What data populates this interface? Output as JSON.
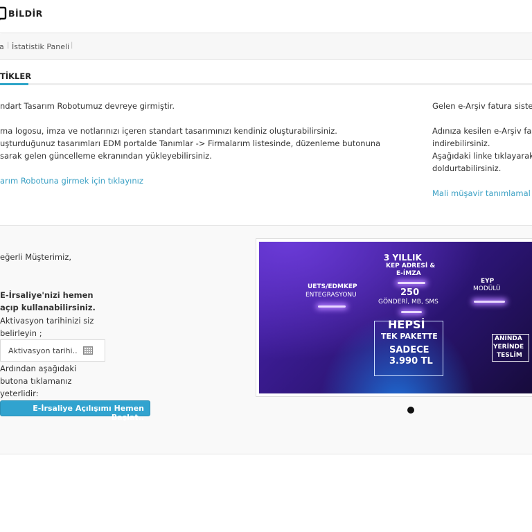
{
  "header": {
    "logo_text": "BİLDİR"
  },
  "breadcrumb": {
    "items": [
      "a",
      "İstatistik Paneli"
    ]
  },
  "tabs": [
    {
      "label": "TİKLER",
      "active": true
    }
  ],
  "notice_left": {
    "lines": [
      "ndart Tasarım Robotumuz devreye girmiştir.",
      "ma logosu, imza ve notlarınızı içeren standart tasarımınızı kendiniz oluşturabilirsiniz.",
      "uşturduğunuz tasarımları EDM portalde Tanımlar -> Firmalarım listesinde, düzenleme butonuna",
      "sarak gelen güncelleme ekranından yükleyebilirsiniz."
    ],
    "link": "arım Robotuna girmek için tıklayınız"
  },
  "notice_right": {
    "lines": [
      "Gelen e-Arşiv fatura siste",
      "Adınıza kesilen e-Arşiv fa",
      "indirebilirsiniz.",
      "Aşağıdaki linke tıklayarak",
      "doldurtabilirsiniz."
    ],
    "link": "Mali müşavir tanımlamal"
  },
  "eirsaliye": {
    "greeting": "eğerli Müşterimiz,",
    "bold1": "E-İrsaliye'nizi hemen",
    "bold2": "açıp kullanabilirsiniz.",
    "text1": "Aktivasyon tarihinizi siz",
    "text2": "belirleyin ;",
    "date_placeholder": "Aktivasyon tarihi..",
    "text3": "Ardından aşağıdaki",
    "text4": "butona tıklamanız",
    "text5": "yeterlidir:",
    "button": "E-İrsaliye Açılışımı Hemen Başlat.."
  },
  "banner": {
    "t1": "3 YILLIK",
    "t2": "KEP ADRESİ &",
    "t3": "E-İMZA",
    "uets": "UETS/EDMKEP",
    "uets2": "ENTEGRASYONU",
    "n250": "250",
    "n250b": "GÖNDERİ, MB, SMS",
    "eyp": "EYP",
    "eyp2": "MODÜLÜ",
    "hepsi": "HEPSİ",
    "tek": "TEK PAKETTE",
    "sadece": "SADECE",
    "price": "3.990 TL",
    "anında": "ANINDA",
    "yerinde": "YERİNDE",
    "teslim": "TESLİM"
  },
  "colors": {
    "accent": "#2ea5c8",
    "link": "#3aa0c4",
    "button": "#31a3cf"
  }
}
